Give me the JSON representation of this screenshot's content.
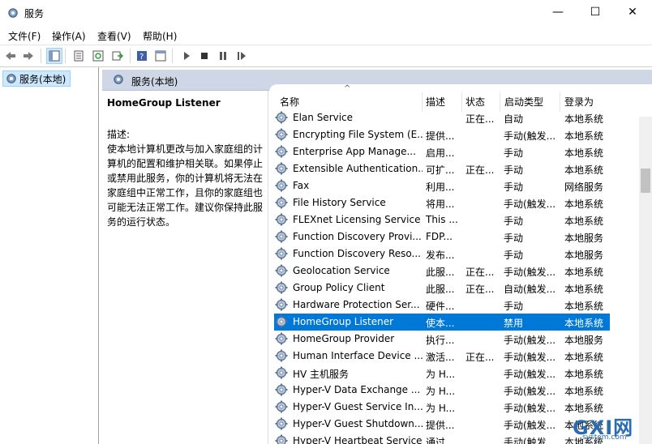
{
  "window": {
    "title": "服务",
    "minimize": "—",
    "maximize": "☐",
    "close": "✕"
  },
  "menu": [
    "文件(F)",
    "操作(A)",
    "查看(V)",
    "帮助(H)"
  ],
  "toolbar": {
    "icons": [
      "back-icon",
      "forward-icon",
      "show-tree-icon",
      "properties-icon",
      "refresh-icon",
      "export-icon",
      "help-icon",
      "show-console-icon",
      "start-icon",
      "stop-icon",
      "pause-icon",
      "restart-icon"
    ]
  },
  "tree": {
    "root": "服务(本地)"
  },
  "content": {
    "header": "服务(本地)",
    "selected_name": "HomeGroup Listener",
    "desc_label": "描述:",
    "desc_text": "使本地计算机更改与加入家庭组的计算机的配置和维护相关联。如果停止或禁用此服务，你的计算机将无法在家庭组中正常工作，且你的家庭组也可能无法正常工作。建议你保持此服务的运行状态。"
  },
  "columns": {
    "name": "名称",
    "desc": "描述",
    "status": "状态",
    "startup": "启动类型",
    "logon": "登录为"
  },
  "sort_indicator": "^",
  "services": [
    {
      "name": "Elan Service",
      "desc": "",
      "status": "正在...",
      "startup": "自动",
      "logon": "本地系统"
    },
    {
      "name": "Encrypting File System (E...",
      "desc": "提供...",
      "status": "",
      "startup": "手动(触发...",
      "logon": "本地系统"
    },
    {
      "name": "Enterprise App Manage...",
      "desc": "启用...",
      "status": "",
      "startup": "手动",
      "logon": "本地系统"
    },
    {
      "name": "Extensible Authentication...",
      "desc": "可扩...",
      "status": "正在...",
      "startup": "手动",
      "logon": "本地系统"
    },
    {
      "name": "Fax",
      "desc": "利用...",
      "status": "",
      "startup": "手动",
      "logon": "网络服务"
    },
    {
      "name": "File History Service",
      "desc": "将用...",
      "status": "",
      "startup": "手动(触发...",
      "logon": "本地系统"
    },
    {
      "name": "FLEXnet Licensing Service",
      "desc": "This ...",
      "status": "",
      "startup": "手动",
      "logon": "本地系统"
    },
    {
      "name": "Function Discovery Provi...",
      "desc": "FDP...",
      "status": "",
      "startup": "手动",
      "logon": "本地服务"
    },
    {
      "name": "Function Discovery Reso...",
      "desc": "发布...",
      "status": "",
      "startup": "手动",
      "logon": "本地服务"
    },
    {
      "name": "Geolocation Service",
      "desc": "此服...",
      "status": "正在...",
      "startup": "手动(触发...",
      "logon": "本地系统"
    },
    {
      "name": "Group Policy Client",
      "desc": "此服...",
      "status": "正在...",
      "startup": "自动(触发...",
      "logon": "本地系统"
    },
    {
      "name": "Hardware Protection Ser...",
      "desc": "硬件...",
      "status": "",
      "startup": "手动",
      "logon": "本地系统"
    },
    {
      "name": "HomeGroup Listener",
      "desc": "使本...",
      "status": "",
      "startup": "禁用",
      "logon": "本地系统",
      "selected": true
    },
    {
      "name": "HomeGroup Provider",
      "desc": "执行...",
      "status": "",
      "startup": "手动(触发...",
      "logon": "本地服务"
    },
    {
      "name": "Human Interface Device ...",
      "desc": "激活...",
      "status": "正在...",
      "startup": "手动(触发...",
      "logon": "本地系统"
    },
    {
      "name": "HV 主机服务",
      "desc": "为 H...",
      "status": "",
      "startup": "手动(触发...",
      "logon": "本地系统"
    },
    {
      "name": "Hyper-V Data Exchange ...",
      "desc": "为 H...",
      "status": "",
      "startup": "手动(触发...",
      "logon": "本地系统"
    },
    {
      "name": "Hyper-V Guest Service In...",
      "desc": "为 H...",
      "status": "",
      "startup": "手动(触发...",
      "logon": "本地系统"
    },
    {
      "name": "Hyper-V Guest Shutdown...",
      "desc": "提供...",
      "status": "",
      "startup": "手动(触发...",
      "logon": "本地系统"
    },
    {
      "name": "Hyper-V Heartbeat Service",
      "desc": "通过...",
      "status": "",
      "startup": "手动(触发...",
      "logon": "本地系统"
    }
  ],
  "watermark": {
    "big": "GXI网",
    "small": "system.com"
  },
  "colors": {
    "selection": "#0078d7",
    "header_band": "#cfd7e6",
    "tree_selection": "#cce8ff"
  }
}
